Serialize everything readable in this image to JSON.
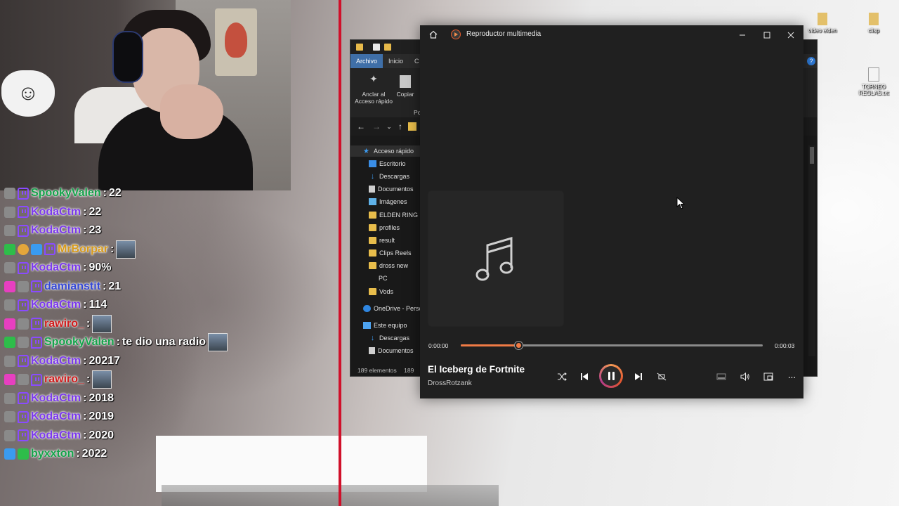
{
  "stream": {
    "chat": [
      {
        "user": "SpookyValen",
        "msg": "22",
        "badges": [
          "gray",
          "twitch"
        ],
        "color": "teal"
      },
      {
        "user": "KodaCtm",
        "msg": "22",
        "badges": [
          "gray",
          "twitch"
        ],
        "color": "purple"
      },
      {
        "user": "KodaCtm",
        "msg": "23",
        "badges": [
          "gray",
          "twitch"
        ],
        "color": "purple"
      },
      {
        "user": "MrBorpar",
        "msg": "",
        "badges": [
          "green",
          "gold",
          "blue",
          "twitch"
        ],
        "color": "gold",
        "emote": true
      },
      {
        "user": "KodaCtm",
        "msg": "90%",
        "badges": [
          "gray",
          "twitch"
        ],
        "color": "purple"
      },
      {
        "user": "damianstit",
        "msg": "21",
        "badges": [
          "pink",
          "gray",
          "twitch"
        ],
        "color": "blue"
      },
      {
        "user": "KodaCtm",
        "msg": "114",
        "badges": [
          "gray",
          "twitch"
        ],
        "color": "purple"
      },
      {
        "user": "rawiro_",
        "msg": "",
        "badges": [
          "pink",
          "gray",
          "twitch"
        ],
        "color": "red",
        "emote": true
      },
      {
        "user": "SpookyValen",
        "msg": "te dio una radio",
        "badges": [
          "green",
          "gray",
          "twitch"
        ],
        "color": "teal",
        "emote": true
      },
      {
        "user": "KodaCtm",
        "msg": "20217",
        "badges": [
          "gray",
          "twitch"
        ],
        "color": "purple"
      },
      {
        "user": "rawiro_",
        "msg": "",
        "badges": [
          "pink",
          "gray",
          "twitch"
        ],
        "color": "red",
        "emote": true
      },
      {
        "user": "KodaCtm",
        "msg": "2018",
        "badges": [
          "gray",
          "twitch"
        ],
        "color": "purple"
      },
      {
        "user": "KodaCtm",
        "msg": "2019",
        "badges": [
          "gray",
          "twitch"
        ],
        "color": "purple"
      },
      {
        "user": "KodaCtm",
        "msg": "2020",
        "badges": [
          "gray",
          "twitch"
        ],
        "color": "purple"
      },
      {
        "user": "byxxton",
        "msg": "2022",
        "badges": [
          "blue",
          "green"
        ],
        "color": "green"
      }
    ]
  },
  "desktop": {
    "icons": [
      {
        "label": "video elden"
      },
      {
        "label": "clisp"
      },
      {
        "label": "TORNEO REGLAS.txt"
      }
    ]
  },
  "explorer": {
    "tabs": [
      "Archivo",
      "Inicio",
      "C"
    ],
    "ribbon": {
      "pin_label": "Anclar al Acceso rápido",
      "copy_label": "Copiar",
      "group_label": "Po"
    },
    "tree": [
      {
        "label": "Acceso rápido",
        "icon": "star"
      },
      {
        "label": "Escritorio",
        "icon": "desktop"
      },
      {
        "label": "Descargas",
        "icon": "download"
      },
      {
        "label": "Documentos",
        "icon": "doc"
      },
      {
        "label": "Imágenes",
        "icon": "image"
      },
      {
        "label": "ELDEN RING",
        "icon": "folder"
      },
      {
        "label": "profiles",
        "icon": "folder"
      },
      {
        "label": "result",
        "icon": "folder"
      },
      {
        "label": "Clips Reels",
        "icon": "folder"
      },
      {
        "label": "dross new",
        "icon": "folder"
      },
      {
        "label": "PC",
        "icon": "none"
      },
      {
        "label": "Vods",
        "icon": "folder"
      },
      {
        "label": "OneDrive - Perso",
        "icon": "cloud"
      },
      {
        "label": "Este equipo",
        "icon": "pc"
      },
      {
        "label": "Descargas",
        "icon": "download"
      },
      {
        "label": "Documentos",
        "icon": "doc"
      }
    ],
    "status": "189 elementos",
    "status2": "189"
  },
  "player": {
    "app_title": "Reproductor multimedia",
    "song_title": "El Iceberg de Fortnite",
    "artist": "DrossRotzank",
    "time_current": "0:00:00",
    "time_total": "0:00:03",
    "progress": 0.19,
    "accent": "#f07b45",
    "icons": {
      "home": "home-icon",
      "shuffle": "shuffle-icon",
      "previous": "previous-icon",
      "pause": "pause-icon",
      "next": "next-icon",
      "repeat": "repeat-off-icon",
      "miniplayer": "miniplayer-icon",
      "volume": "volume-icon",
      "cast": "cast-icon",
      "more": "more-icon",
      "music": "music-note-icon"
    }
  }
}
